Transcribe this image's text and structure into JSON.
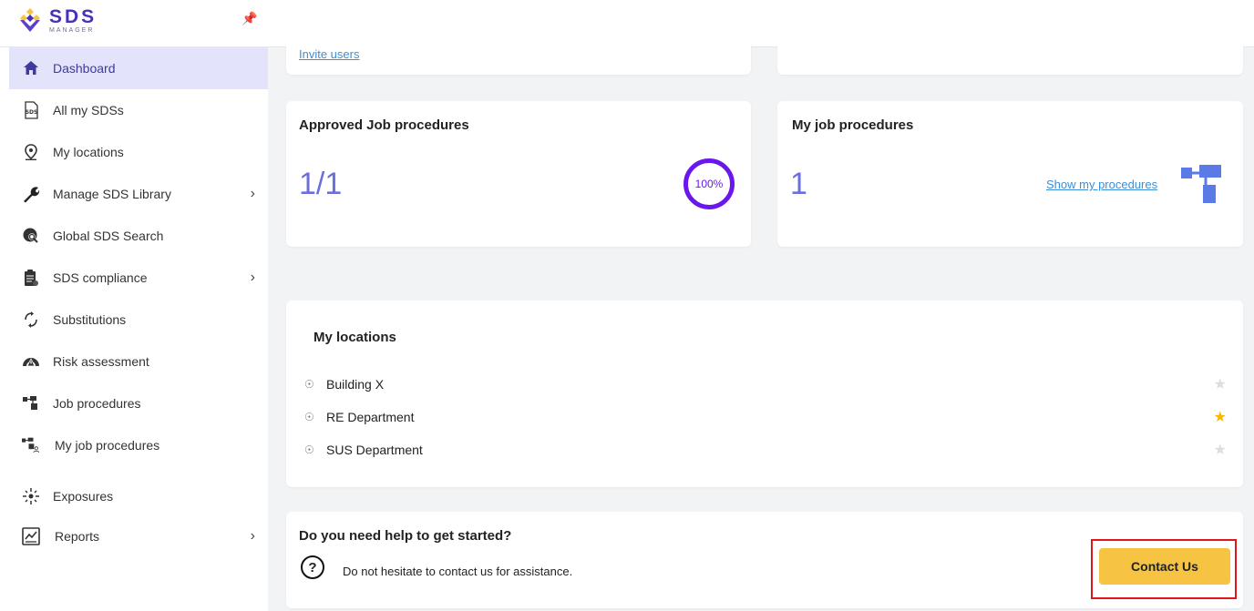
{
  "app": {
    "logo_title": "SDS",
    "logo_sub": "MANAGER"
  },
  "sidebar": {
    "items": [
      {
        "label": "Dashboard",
        "icon": "home-icon",
        "active": true
      },
      {
        "label": "All my SDSs",
        "icon": "sds-doc-icon"
      },
      {
        "label": "My locations",
        "icon": "location-pin-icon"
      },
      {
        "label": "Manage SDS Library",
        "icon": "wrench-icon",
        "has_submenu": true
      },
      {
        "label": "Global SDS Search",
        "icon": "globe-search-icon"
      },
      {
        "label": "SDS compliance",
        "icon": "clipboard-icon",
        "has_submenu": true
      },
      {
        "label": "Substitutions",
        "icon": "refresh-icon"
      },
      {
        "label": "Risk assessment",
        "icon": "gauge-warning-icon"
      },
      {
        "label": "Job procedures",
        "icon": "flowchart-icon"
      },
      {
        "label": "My job procedures",
        "icon": "user-flowchart-icon"
      },
      {
        "label": "Exposures",
        "icon": "exposure-icon"
      },
      {
        "label": "Reports",
        "icon": "chart-report-icon",
        "has_submenu": true
      }
    ]
  },
  "top_card": {
    "invite_link": "Invite users"
  },
  "approved_card": {
    "title": "Approved Job procedures",
    "value": "1/1",
    "percent_label": "100%"
  },
  "my_proc_card": {
    "title": "My job procedures",
    "value": "1",
    "link": "Show my procedures"
  },
  "locations_card": {
    "title": "My locations",
    "items": [
      {
        "label": "Building X",
        "starred": false
      },
      {
        "label": "RE Department",
        "starred": true
      },
      {
        "label": "SUS Department",
        "starred": false
      }
    ]
  },
  "help_card": {
    "title": "Do you need help to get started?",
    "text": "Do not hesitate to contact us for assistance.",
    "button": "Contact Us"
  },
  "colors": {
    "accent": "#6a17ee",
    "button": "#f6c343",
    "highlight": "#e0161d",
    "star_on": "#f6b800"
  }
}
